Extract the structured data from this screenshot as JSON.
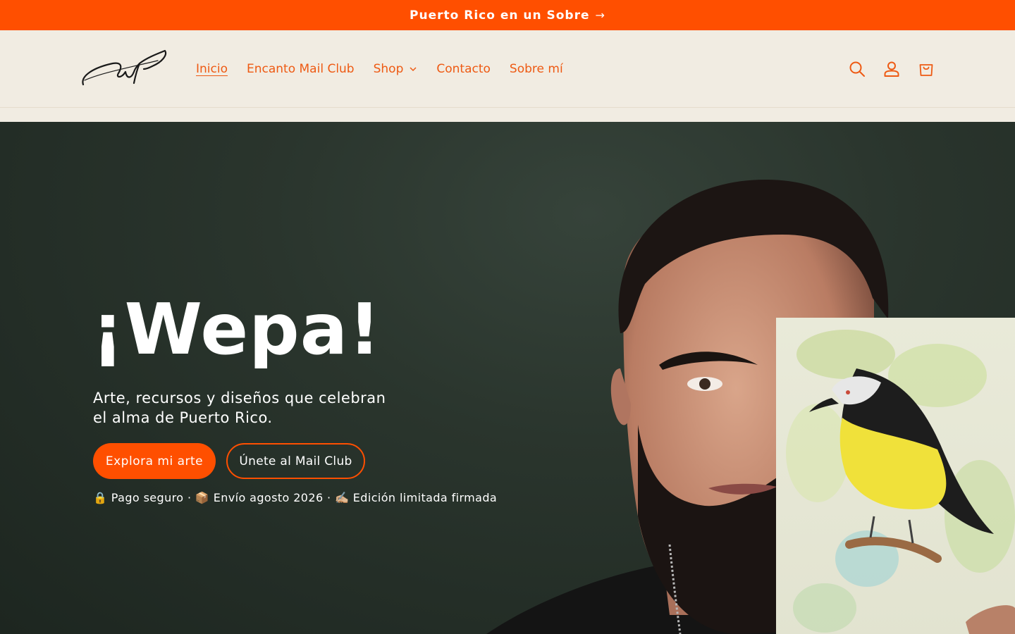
{
  "announcement": {
    "text": "Puerto Rico en un Sobre",
    "arrow": "→"
  },
  "header": {
    "logo": "signature-logo",
    "nav": [
      {
        "label": "Inicio",
        "active": true
      },
      {
        "label": "Encanto Mail Club"
      },
      {
        "label": "Shop",
        "has_dropdown": true
      },
      {
        "label": "Contacto"
      },
      {
        "label": "Sobre mí"
      }
    ],
    "icons": [
      "search-icon",
      "account-icon",
      "cart-icon"
    ]
  },
  "hero": {
    "title": "¡Wepa!",
    "subtitle": "Arte, recursos y diseños que celebran el alma de Puerto Rico.",
    "primary_button": "Explora mi arte",
    "secondary_button": "Únete al Mail Club",
    "trust_line": "🔒 Pago seguro · 📦 Envío agosto 2026 · ✍🏼 Edición limitada firmada"
  },
  "colors": {
    "accent": "#ff4f00",
    "header_bg": "#f1ece2",
    "hero_bg": "#26302a",
    "nav_text": "#ee5a13"
  }
}
